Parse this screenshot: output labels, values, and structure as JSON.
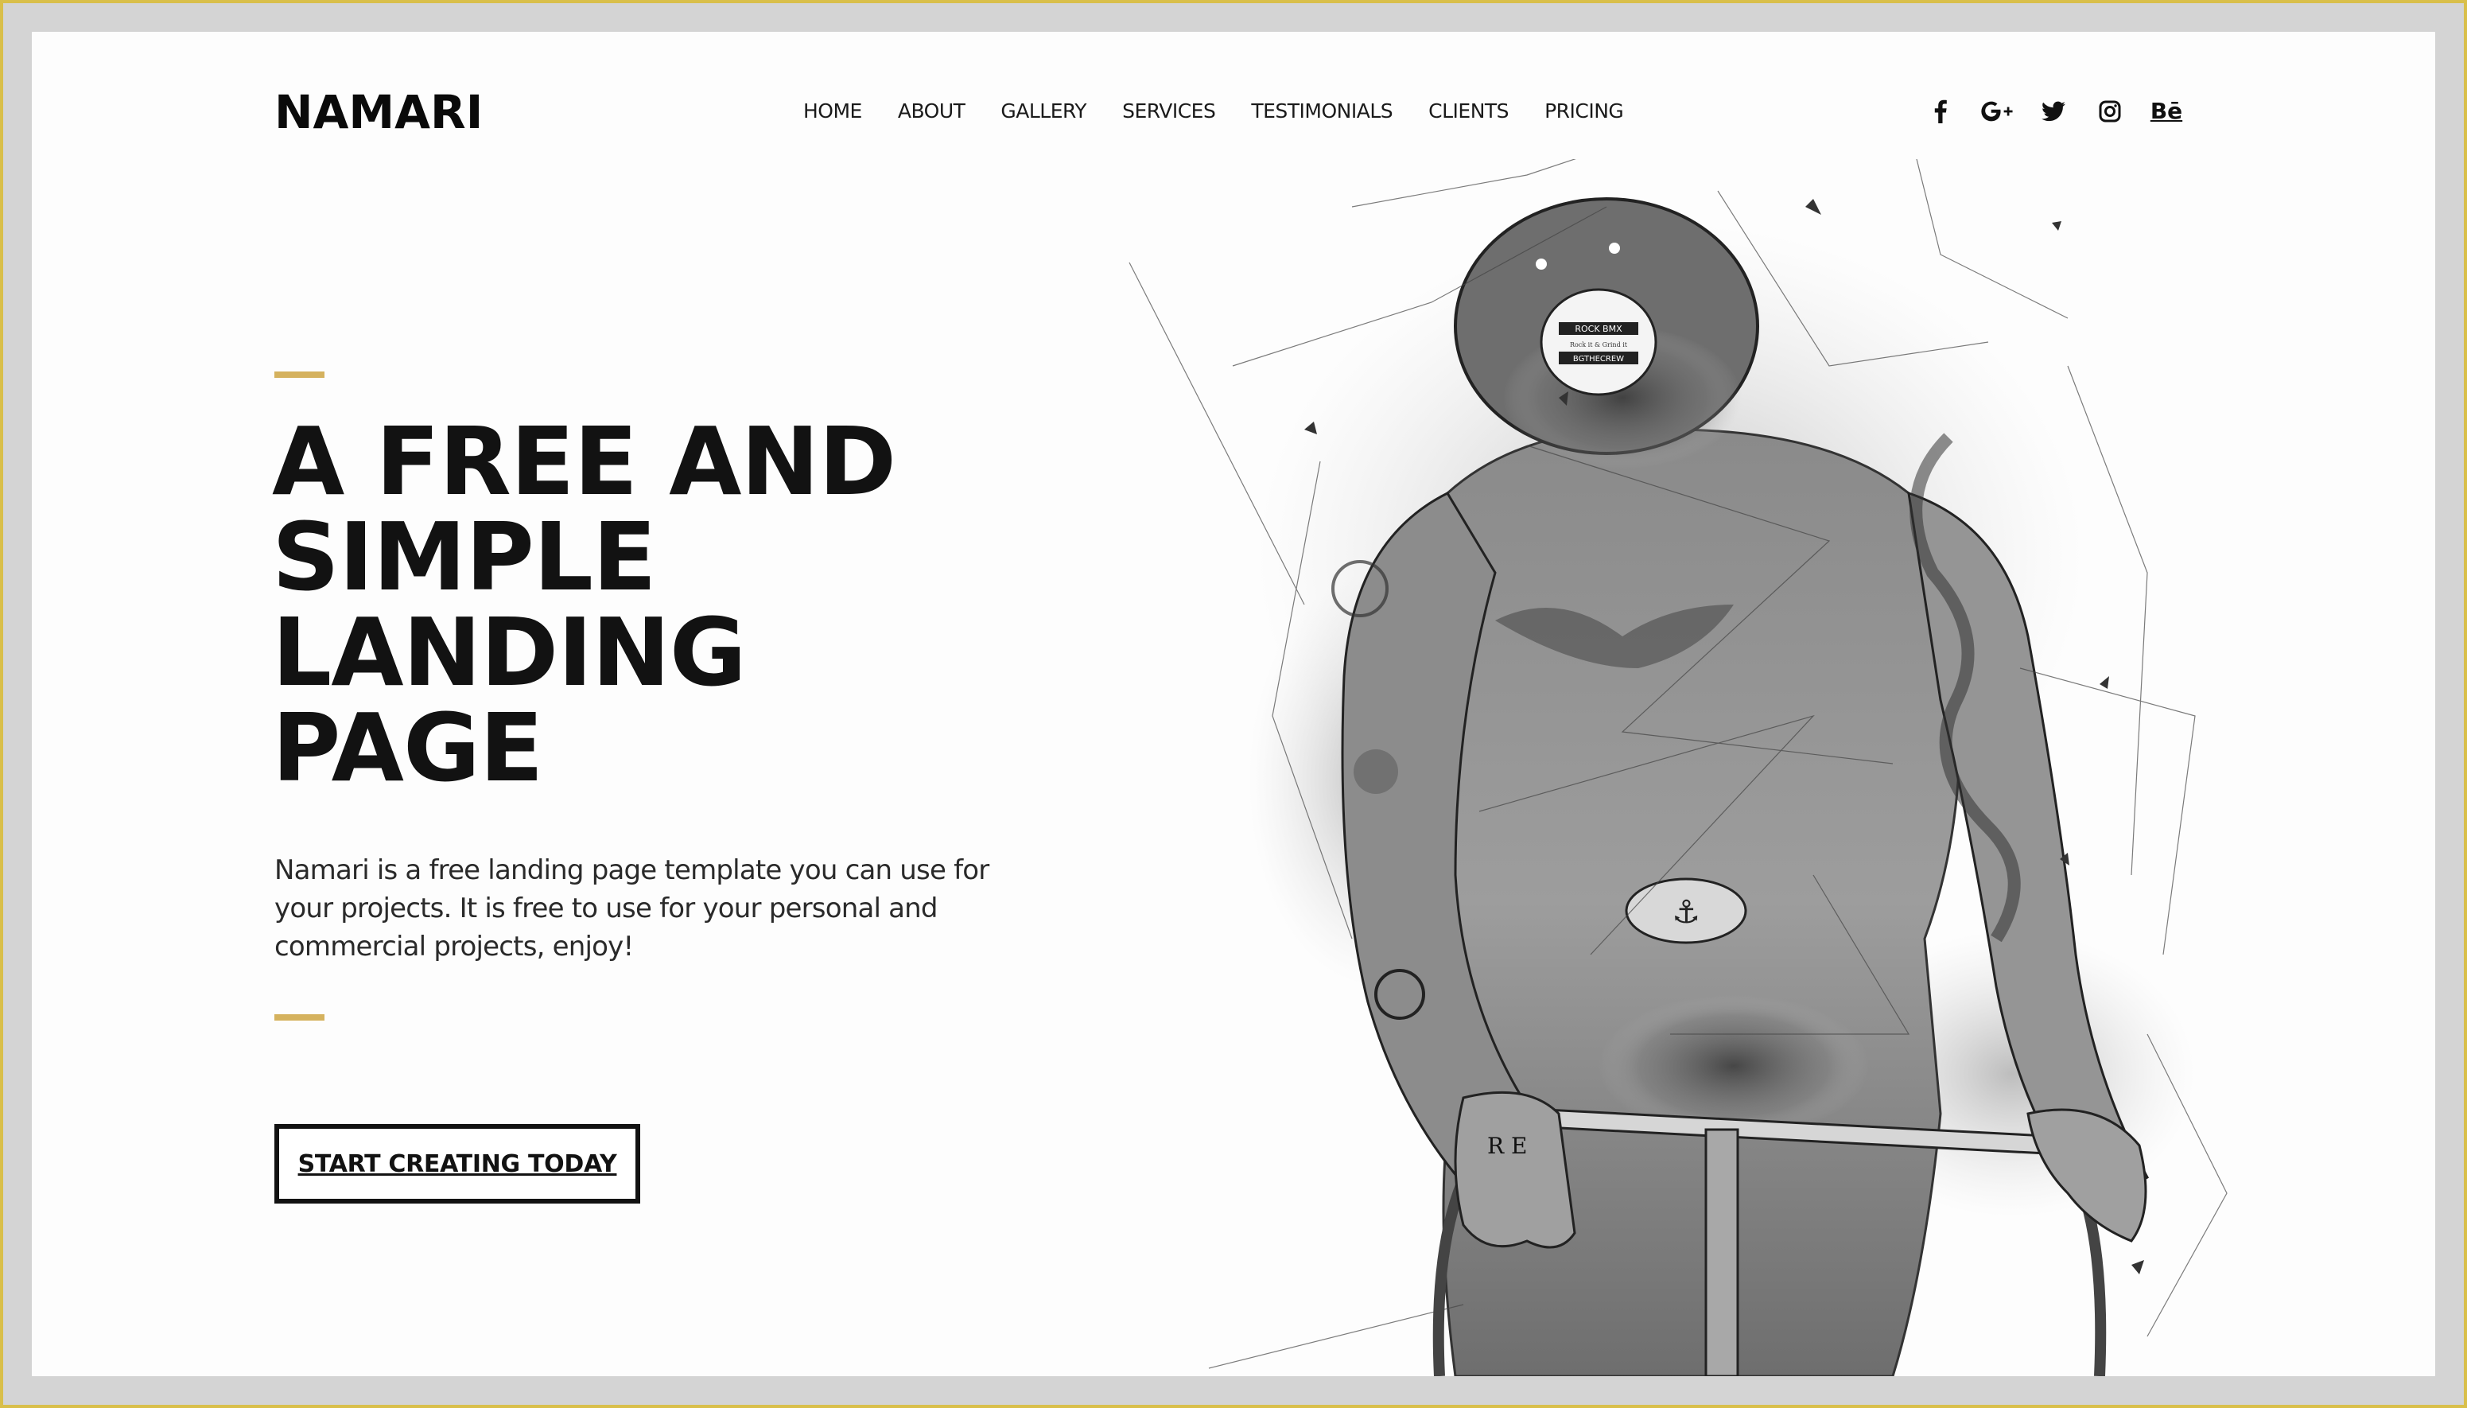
{
  "header": {
    "logo": "NAMARI",
    "nav": [
      {
        "label": "HOME"
      },
      {
        "label": "ABOUT"
      },
      {
        "label": "GALLERY"
      },
      {
        "label": "SERVICES"
      },
      {
        "label": "TESTIMONIALS"
      },
      {
        "label": "CLIENTS"
      },
      {
        "label": "PRICING"
      }
    ],
    "social": [
      {
        "icon": "facebook-icon"
      },
      {
        "icon": "google-plus-icon"
      },
      {
        "icon": "twitter-icon"
      },
      {
        "icon": "instagram-icon"
      },
      {
        "icon": "behance-icon",
        "text": "Bē"
      }
    ]
  },
  "hero": {
    "headline_lines": [
      "A FREE AND",
      "SIMPLE",
      "LANDING",
      "PAGE"
    ],
    "description": "Namari is a free landing page template you can use for your projects. It is free to use for your personal and commercial projects, enjoy!",
    "cta_label": "START CREATING TODAY",
    "illustration": {
      "subject": "sketch-style tattooed cyclist illustration",
      "cap_badge_text": [
        "ROCK BMX",
        "Rock it & Grind it",
        "BGTHECREW"
      ]
    }
  },
  "colors": {
    "accent": "#d5b25e",
    "text": "#121212",
    "background": "#fdfdfd",
    "frame": "#d4d4d4",
    "frame_border": "#d9bf4a"
  }
}
